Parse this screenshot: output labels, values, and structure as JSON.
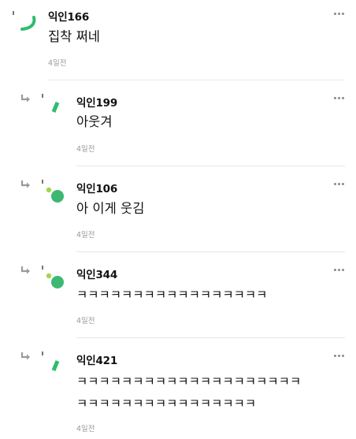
{
  "comments": [
    {
      "author": "익인166",
      "text": "집착 쩌네",
      "time": "4일전",
      "is_reply": false,
      "avatar": "green-arc"
    },
    {
      "author": "익인199",
      "text": "아웃겨",
      "time": "4일전",
      "is_reply": true,
      "avatar": "green-dash"
    },
    {
      "author": "익인106",
      "text": "아 이게 웃김",
      "time": "4일전",
      "is_reply": true,
      "avatar": "green-dots"
    },
    {
      "author": "익인344",
      "text": "ㅋㅋㅋㅋㅋㅋㅋㅋㅋㅋㅋㅋㅋㅋㅋㅋㅋ",
      "time": "4일전",
      "is_reply": true,
      "avatar": "green-dots"
    },
    {
      "author": "익인421",
      "text": "ㅋㅋㅋㅋㅋㅋㅋㅋㅋㅋㅋㅋㅋㅋㅋㅋㅋㅋㅋㅋ\nㅋㅋㅋㅋㅋㅋㅋㅋㅋㅋㅋㅋㅋㅋㅋㅋ",
      "time": "4일전",
      "is_reply": true,
      "avatar": "green-dash"
    }
  ],
  "icons": {
    "reply": "reply-arrow-icon",
    "more": "more-options-icon"
  },
  "colors": {
    "accent": "#2dbd6e",
    "accent_light": "#9ed84a",
    "muted": "#9a9a9a"
  }
}
